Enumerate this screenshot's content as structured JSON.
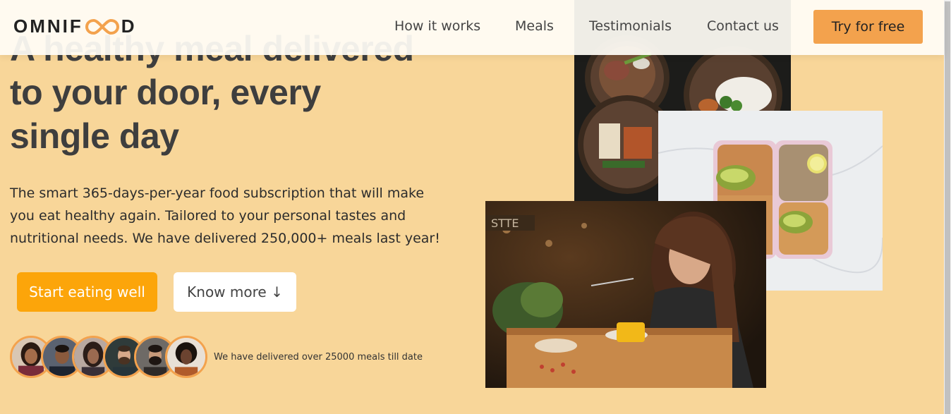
{
  "header": {
    "logo": {
      "text_left": "OMNIF",
      "text_right": "D",
      "icon": "infinity-icon"
    },
    "nav": [
      "How it works",
      "Meals",
      "Testimonials",
      "Contact us"
    ],
    "cta_label": "Try for free"
  },
  "hero": {
    "title_line1": "A healthy meal delivered",
    "title_line2": "to your door, every",
    "title_line3": "single day",
    "description": "The smart 365-days-per-year food subscription that will make you eat healthy again. Tailored to your personal tastes and nutritional needs. We have delivered 250,000+ meals last year!",
    "primary_button": "Start eating well",
    "secondary_button": "Know more ↓",
    "delivered_text": "We have delivered over 25000 meals till date"
  },
  "colors": {
    "background": "#f8d699",
    "accent": "#fca50a",
    "nav_cta": "#f3a24d",
    "text_dark": "#3e3e3e"
  }
}
